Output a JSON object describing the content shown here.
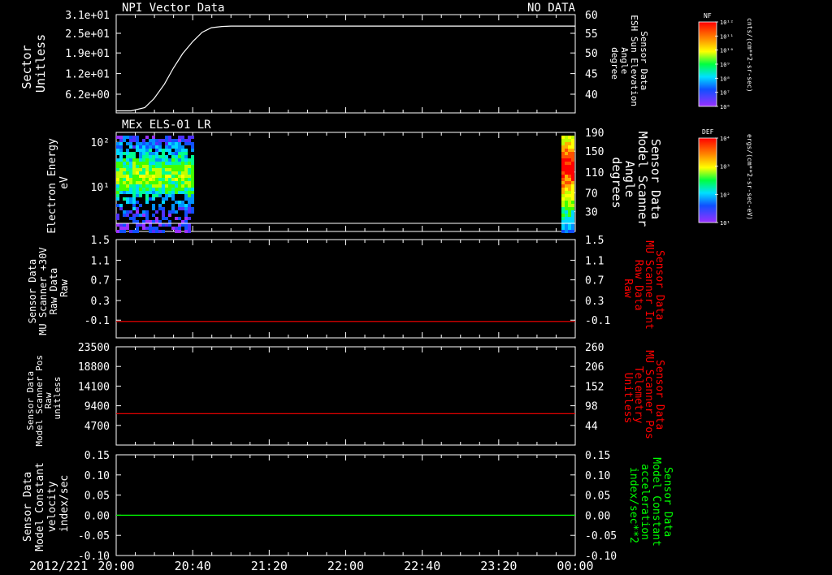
{
  "chart_data": [
    {
      "type": "line",
      "top_left_label": "NPI Vector Data",
      "top_right_label": "NO DATA",
      "ylabel_left": [
        "Sector",
        "Unitless"
      ],
      "left_ticks": [
        "3.1e+01",
        "2.5e+01",
        "1.9e+01",
        "1.2e+01",
        "6.2e+00"
      ],
      "ylabel_right": [
        "Sensor Data",
        "ESH Sun Elevation",
        "Angle",
        "degree"
      ],
      "right_ticks": [
        "60",
        "55",
        "50",
        "45",
        "40"
      ],
      "ylim_right": [
        36,
        60
      ],
      "series": [
        {
          "color": "#ffffff",
          "x": [
            0,
            0.13,
            0.25,
            0.33,
            0.42,
            0.5,
            0.58,
            0.67,
            0.75,
            0.83,
            0.92,
            1.0,
            4.0
          ],
          "values": [
            36.5,
            36.5,
            37.3,
            39.5,
            43.0,
            47.0,
            50.5,
            53.5,
            55.7,
            56.8,
            57.1,
            57.2,
            57.2
          ]
        }
      ]
    },
    {
      "type": "heatmap",
      "top_left_label": "MEx ELS-01 LR",
      "ylabel_left": [
        "Electron Energy",
        "eV"
      ],
      "left_ticks": [
        "10²",
        "10¹"
      ],
      "ylabel_right": [
        "Sensor Data",
        "Model Scanner",
        "Angle",
        "degrees"
      ],
      "right_ticks": [
        "190",
        "150",
        "110",
        "70",
        "30"
      ],
      "ylim_right": [
        0,
        190
      ],
      "data_blocks_hours": [
        [
          0,
          0.67
        ],
        [
          3.88,
          3.97
        ]
      ],
      "line_value": 0
    },
    {
      "type": "line",
      "ylabel_left": [
        "Sensor Data",
        "MU Scanner +30V",
        "Raw Data",
        "Raw"
      ],
      "left_ticks": [
        "1.5",
        "1.1",
        "0.7",
        "0.3",
        "-0.1"
      ],
      "ylabel_right": [
        "Sensor Data",
        "MU Scanner Int",
        "Raw Data",
        "Raw"
      ],
      "right_ticks": [
        "1.5",
        "1.1",
        "0.7",
        "0.3",
        "-0.1"
      ],
      "ylim": [
        -0.3,
        1.5
      ],
      "series": [
        {
          "color": "#ff0000",
          "x": [
            0,
            4
          ],
          "values": [
            0,
            0
          ]
        }
      ]
    },
    {
      "type": "line",
      "ylabel_left": [
        "Sensor Data",
        "Model Scanner Pos",
        "Raw",
        "unitless"
      ],
      "left_ticks": [
        "23500",
        "18800",
        "14100",
        "9400",
        "4700"
      ],
      "ylabel_right": [
        "Sensor Data",
        "MU Scanner Pos",
        "Telemetry",
        "Unitless"
      ],
      "right_ticks": [
        "260",
        "206",
        "152",
        "98",
        "44"
      ],
      "ylim_right": [
        10,
        260
      ],
      "series": [
        {
          "color": "#ff0000",
          "x": [
            0,
            4
          ],
          "values": [
            90,
            90
          ]
        }
      ]
    },
    {
      "type": "line",
      "ylabel_left": [
        "Sensor Data",
        "Model Constant",
        "velocity",
        "index/sec"
      ],
      "left_ticks": [
        "0.15",
        "0.10",
        "0.05",
        "0.00",
        "-0.05",
        "-0.10"
      ],
      "ylabel_right": [
        "Sensor Data",
        "Model Constant",
        "acceleration",
        "index/sec**2"
      ],
      "right_ticks": [
        "0.15",
        "0.10",
        "0.05",
        "0.00",
        "-0.05",
        "-0.10"
      ],
      "ylim": [
        -0.1,
        0.15
      ],
      "series": [
        {
          "color": "#00ff00",
          "x": [
            0,
            4
          ],
          "values": [
            0,
            0
          ]
        }
      ]
    }
  ],
  "x_axis": {
    "date_label": "2012/221",
    "ticks": [
      "20:00",
      "20:40",
      "21:20",
      "22:00",
      "22:40",
      "23:20",
      "00:00"
    ],
    "xlim_hours": [
      0,
      4
    ]
  },
  "colorbars": [
    {
      "title": "NF",
      "label": "cnts/(cm**2-sr-sec)",
      "tick_labels": [
        "10¹²",
        "10¹¹",
        "10¹⁰",
        "10⁹",
        "10⁸",
        "10⁷",
        "10⁶"
      ]
    },
    {
      "title": "DEF",
      "label": "ergs/(cm**2-sr-sec-eV)",
      "tick_labels": [
        "10⁴",
        "10³",
        "10²",
        "10¹"
      ]
    }
  ],
  "colors": {
    "frame": "#ffffff",
    "red_label": "#ff0000",
    "green_label": "#00ff00"
  }
}
